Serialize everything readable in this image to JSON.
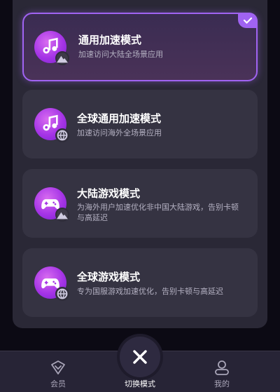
{
  "modes": [
    {
      "title": "通用加速模式",
      "desc": "加速访问大陆全场景应用",
      "icon": "music-note-icon",
      "badge": "mountain-icon",
      "selected": true
    },
    {
      "title": "全球通用加速模式",
      "desc": "加速访问海外全场景应用",
      "icon": "music-note-icon",
      "badge": "globe-icon",
      "selected": false
    },
    {
      "title": "大陆游戏模式",
      "desc": "为海外用户加速优化非中国大陆游戏，告别卡顿与高延迟",
      "icon": "gamepad-icon",
      "badge": "mountain-icon",
      "selected": false
    },
    {
      "title": "全球游戏模式",
      "desc": "专为国服游戏加速优化，告别卡顿与高延迟",
      "icon": "gamepad-icon",
      "badge": "globe-icon",
      "selected": false
    }
  ],
  "tabbar": {
    "member": "会员",
    "switch_mode": "切换模式",
    "mine": "我的"
  },
  "colors": {
    "accent": "#a063f2",
    "icon_gradient_start": "#d86cf0",
    "icon_gradient_end": "#7a22cf",
    "card_bg": "#353342",
    "sheet_bg": "#2a2836"
  }
}
